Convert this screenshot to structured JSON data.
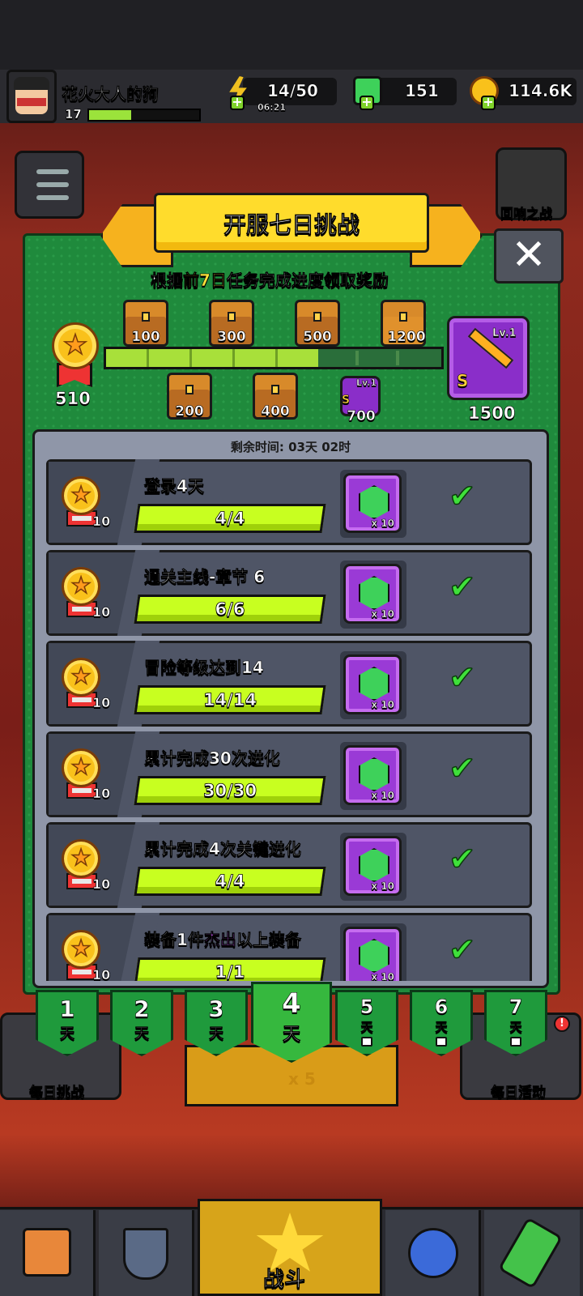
{
  "player": {
    "name": "花火大人的狗",
    "level": "17"
  },
  "resources": {
    "energy": "14/50",
    "energy_timer": "06:21",
    "gems": "151",
    "gold": "114.6K"
  },
  "side_buttons": {
    "echo_battle": "回响之战",
    "daily_challenge": "每日挑战",
    "daily_activity": "每日活动"
  },
  "modal": {
    "title": "开服七日挑战",
    "subtitle_prefix": "根据",
    "subtitle_highlight": "前7日",
    "subtitle_suffix": "任务完成进度领取奖励",
    "score": "510",
    "milestones_top": [
      "100",
      "300",
      "500",
      "1200"
    ],
    "milestones_bottom": [
      "200",
      "400",
      "700"
    ],
    "small_reward_level": "Lv.1",
    "small_reward_rank": "S",
    "big_reward_level": "Lv.1",
    "big_reward_rank": "S",
    "big_reward_points": "1500",
    "progress_fraction": 0.52,
    "remaining_time": "剩余时间: 03天 02时"
  },
  "tasks": [
    {
      "title": "登录4天",
      "progress": "4/4",
      "points": "10",
      "reward_qty": "x 10"
    },
    {
      "title": "通关主线-章节 6",
      "progress": "6/6",
      "points": "10",
      "reward_qty": "x 10"
    },
    {
      "title": "冒险等级达到14",
      "progress": "14/14",
      "points": "10",
      "reward_qty": "x 10"
    },
    {
      "title": "累计完成30次进化",
      "progress": "30/30",
      "points": "10",
      "reward_qty": "x 10"
    },
    {
      "title": "累计完成4次关键进化",
      "progress": "4/4",
      "points": "10",
      "reward_qty": "x 10"
    },
    {
      "title_prefix": "装备1件",
      "title_highlight": "杰出",
      "title_suffix": "以上装备",
      "progress": "1/1",
      "points": "10",
      "reward_qty": "x 10"
    }
  ],
  "days": [
    {
      "num": "1",
      "label": "天",
      "locked": false
    },
    {
      "num": "2",
      "label": "天",
      "locked": false
    },
    {
      "num": "3",
      "label": "天",
      "locked": false
    },
    {
      "num": "4",
      "label": "天",
      "locked": false
    },
    {
      "num": "5",
      "label": "天",
      "locked": true
    },
    {
      "num": "6",
      "label": "天",
      "locked": true
    },
    {
      "num": "7",
      "label": "天",
      "locked": true
    }
  ],
  "behind": {
    "energy_multiplier": "x 5"
  },
  "bottom_nav": {
    "battle_label": "战斗"
  }
}
